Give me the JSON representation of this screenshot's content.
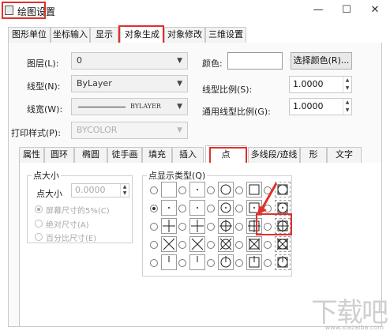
{
  "window": {
    "title": "绘图设置",
    "minimize": "—",
    "maximize": "☐",
    "close": "✕"
  },
  "top_tabs": [
    {
      "label": "图形单位",
      "active": false
    },
    {
      "label": "坐标输入",
      "active": false
    },
    {
      "label": "显示",
      "active": false
    },
    {
      "label": "对象生成",
      "active": true
    },
    {
      "label": "对象修改",
      "active": false
    },
    {
      "label": "三维设置",
      "active": false
    }
  ],
  "form": {
    "layer_label": "图层(L):",
    "layer_value": "0",
    "linetype_label": "线型(N):",
    "linetype_value": "ByLayer",
    "lineweight_label": "线宽(W):",
    "lineweight_value": "BYLAYER",
    "plotstyle_label": "打印样式(P):",
    "plotstyle_value": "BYCOLOR",
    "color_label": "颜色:",
    "select_color_button": "选择颜色(R)...",
    "linetype_scale_label": "线型比例(S):",
    "linetype_scale_value": "1.0000",
    "global_scale_label": "通用线型比例(G):",
    "global_scale_value": "1.0000"
  },
  "inner_tabs": [
    {
      "label": "属性",
      "active": false
    },
    {
      "label": "圆环",
      "active": false
    },
    {
      "label": "椭圆",
      "active": false
    },
    {
      "label": "徒手画",
      "active": false
    },
    {
      "label": "填充",
      "active": false
    },
    {
      "label": "插入",
      "active": false
    },
    {
      "label": "点",
      "active": true
    },
    {
      "label": "多线段/迹线",
      "active": false
    },
    {
      "label": "形",
      "active": false
    },
    {
      "label": "文字",
      "active": false
    }
  ],
  "point_size": {
    "group_title": "点大小",
    "size_label": "点大小",
    "size_value": "0.0000",
    "options": [
      {
        "label": "屏幕尺寸的5%(C)",
        "checked": true
      },
      {
        "label": "绝对尺寸(A)",
        "checked": false
      },
      {
        "label": "百分比尺寸(E)",
        "checked": false
      }
    ]
  },
  "point_display": {
    "group_title": "点显示类型(Q)",
    "selected_index": 5,
    "highlighted_index": 13,
    "styles": [
      "blank",
      "dot",
      "circle",
      "square",
      "circle-square",
      "dot",
      "dot",
      "circle-dot",
      "square-dot",
      "circle-square-dot",
      "plus",
      "plus",
      "circle-plus",
      "square-plus",
      "circle-square-plus",
      "x",
      "x",
      "circle-x",
      "square-x",
      "circle-square-x",
      "tick",
      "tick",
      "circle-tick",
      "square-tick",
      "circle-square-tick"
    ]
  },
  "watermark": {
    "text": "下载吧",
    "url": "www.xiazaiba.com"
  },
  "colors": {
    "highlight": "#e0312a",
    "border": "#c8c8c8"
  }
}
